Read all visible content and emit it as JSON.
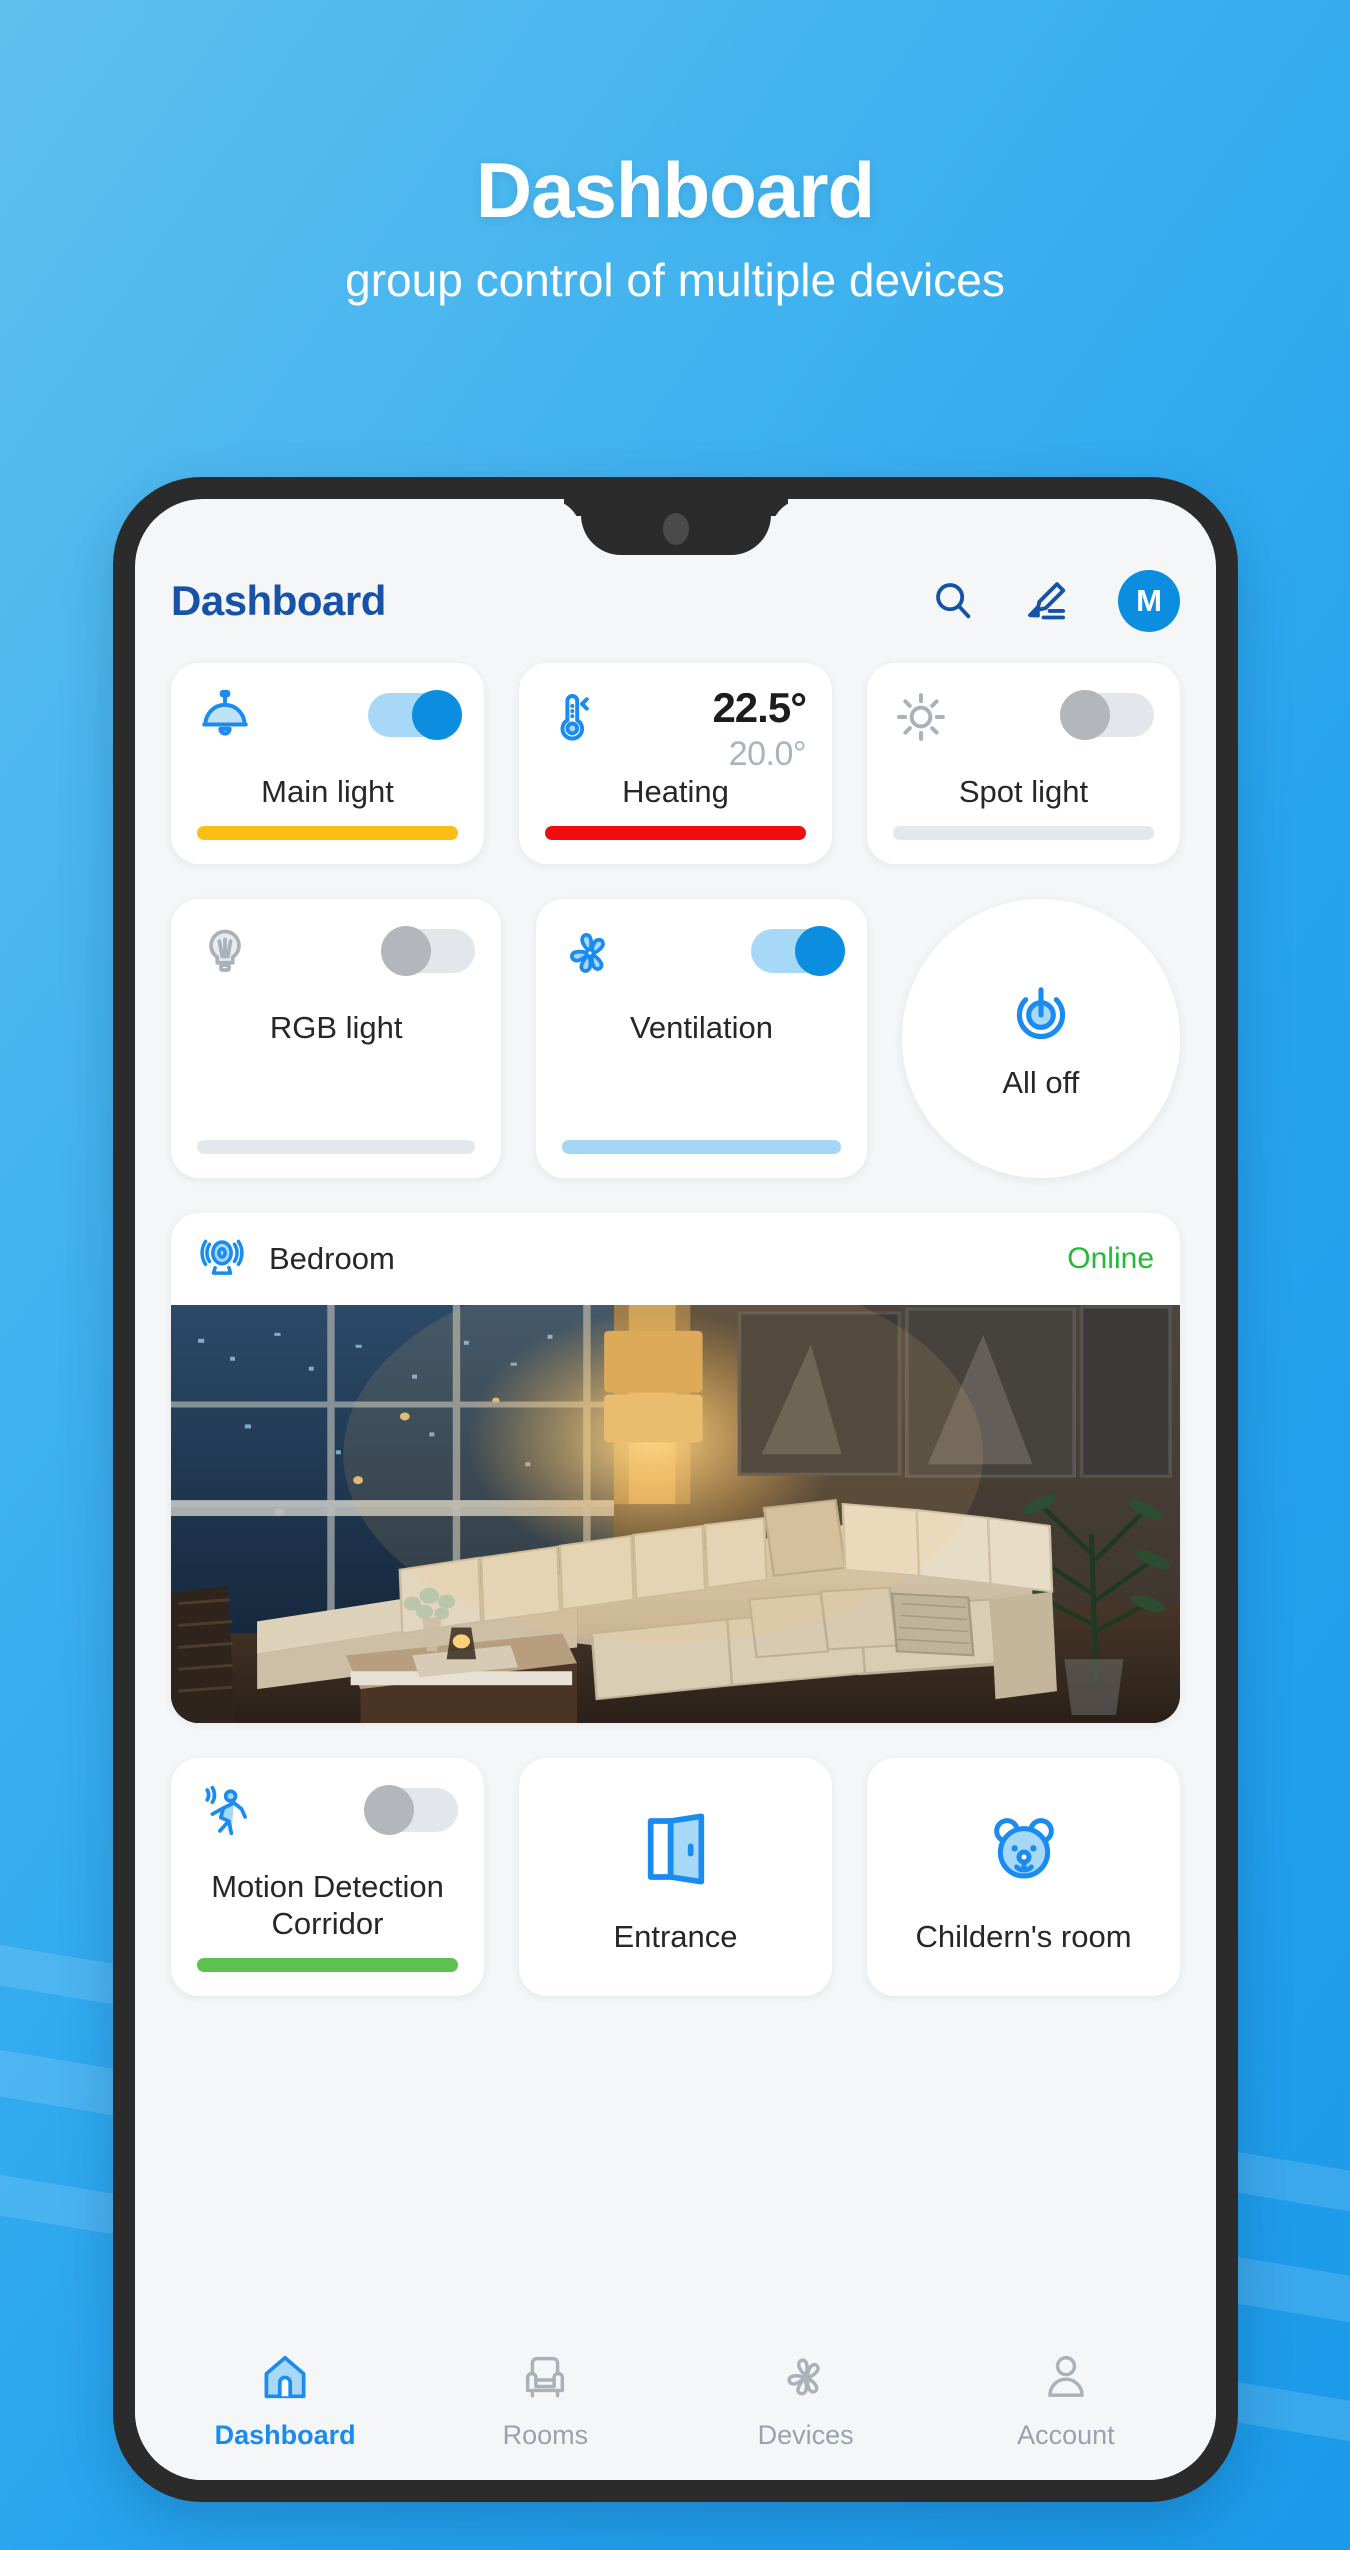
{
  "promo": {
    "title": "Dashboard",
    "subtitle": "group control of multiple devices"
  },
  "colors": {
    "background_gradient_start": "#5ec0ef",
    "background_gradient_end": "#1b9ae9",
    "accent_blue": "#0b8ee0",
    "title_blue": "#1552a8",
    "online_green": "#20bd33",
    "bar_yellow": "#fcbd17",
    "bar_red": "#f20d0d",
    "bar_green": "#5cc14e",
    "bar_lightblue": "#a6d6f5",
    "bar_grey": "#e4e7ec",
    "toggle_off_knob": "#b3b6ba"
  },
  "app": {
    "header": {
      "title": "Dashboard",
      "search_icon": "search-icon",
      "edit_icon": "edit-pencil-icon",
      "avatar_initial": "M"
    },
    "row1": [
      {
        "id": "main-light",
        "icon": "pendant-lamp-icon",
        "label": "Main light",
        "toggle": "on",
        "bar_color": "#fcbd17",
        "bar_fill_percent": 100
      },
      {
        "id": "heating",
        "icon": "thermometer-icon",
        "label": "Heating",
        "current_temp": "22.5°",
        "target_temp": "20.0°",
        "bar_color": "#f20d0d",
        "bar_fill_percent": 100
      },
      {
        "id": "spot-light",
        "icon": "sun-spotlight-icon",
        "label": "Spot light",
        "toggle": "off",
        "bar_color": "#e4e7ec",
        "bar_fill_percent": 100
      }
    ],
    "row2": [
      {
        "id": "rgb-light",
        "icon": "bulb-icon",
        "label": "RGB light",
        "toggle": "off",
        "bar_color": "#e4e7ec",
        "bar_fill_percent": 100
      },
      {
        "id": "ventilation",
        "icon": "fan-icon",
        "label": "Ventilation",
        "toggle": "on",
        "bar_color": "#a6d6f5",
        "bar_fill_percent": 100
      },
      {
        "id": "all-off",
        "icon": "power-icon",
        "label": "All off"
      }
    ],
    "camera": {
      "icon": "camera-icon",
      "name": "Bedroom",
      "status": "Online"
    },
    "row3": [
      {
        "id": "motion-detection",
        "icon": "running-person-icon",
        "label": "Motion Detection Corridor",
        "toggle": "off",
        "bar_color": "#5cc14e",
        "bar_fill_percent": 100
      },
      {
        "id": "entrance",
        "icon": "open-door-icon",
        "label": "Entrance"
      },
      {
        "id": "childerns-room",
        "icon": "teddy-bear-icon",
        "label": "Childern's room"
      }
    ],
    "bottom_nav": [
      {
        "id": "dashboard",
        "icon": "home-icon",
        "label": "Dashboard",
        "active": true
      },
      {
        "id": "rooms",
        "icon": "armchair-icon",
        "label": "Rooms",
        "active": false
      },
      {
        "id": "devices",
        "icon": "fan-icon",
        "label": "Devices",
        "active": false
      },
      {
        "id": "account",
        "icon": "person-icon",
        "label": "Account",
        "active": false
      }
    ]
  }
}
